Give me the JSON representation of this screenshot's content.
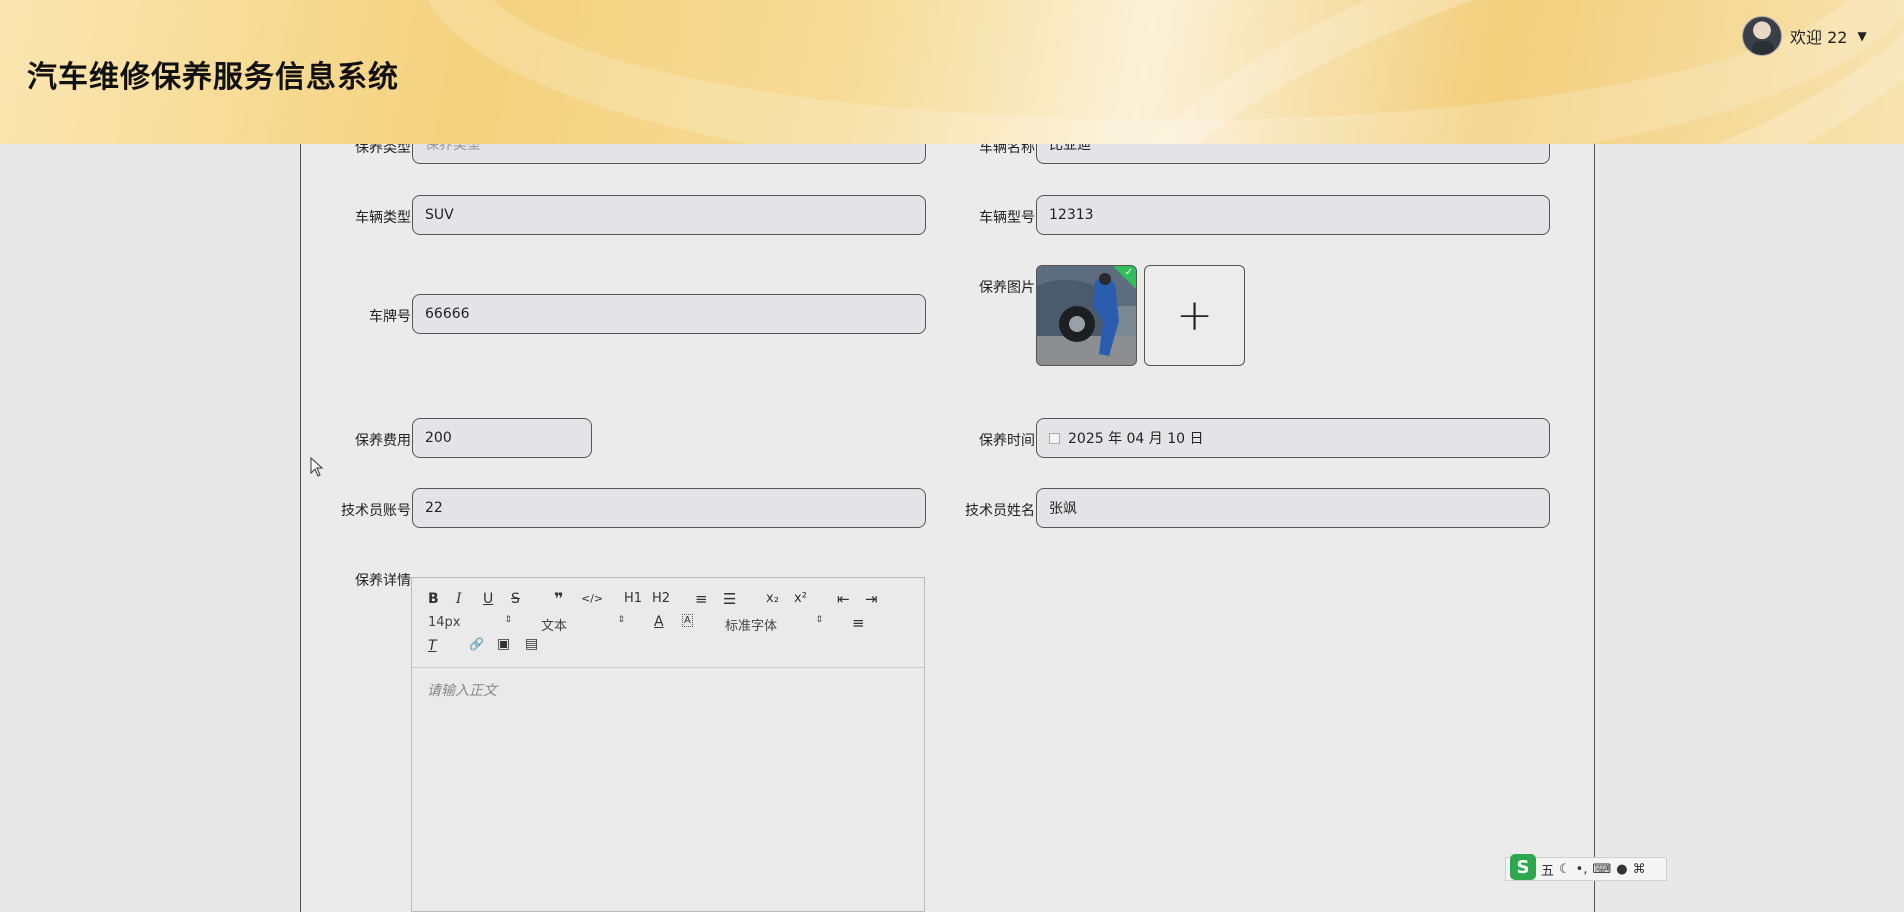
{
  "header": {
    "app_title": "汽车维修保养服务信息系统",
    "welcome": "欢迎 22",
    "caret": "▼"
  },
  "form": {
    "maintenance_type": {
      "label": "保养类型",
      "placeholder": "保养类型"
    },
    "vehicle_name": {
      "label": "车辆名称",
      "value": "比亚迪"
    },
    "vehicle_category": {
      "label": "车辆类型",
      "value": "SUV"
    },
    "vehicle_model": {
      "label": "车辆型号",
      "value": "12313"
    },
    "plate_number": {
      "label": "车牌号",
      "value": "66666"
    },
    "maintenance_image": {
      "label": "保养图片",
      "add_symbol": "+"
    },
    "maintenance_fee": {
      "label": "保养费用",
      "value": "200"
    },
    "maintenance_time": {
      "label": "保养时间",
      "value": "2025 年 04 月 10 日"
    },
    "technician_account": {
      "label": "技术员账号",
      "value": "22"
    },
    "technician_name": {
      "label": "技术员姓名",
      "value": "张飒"
    },
    "maintenance_details": {
      "label": "保养详情",
      "placeholder": "请输入正文",
      "toolbar": {
        "bold": "B",
        "italic": "I",
        "underline": "U",
        "strike": "S",
        "quote": "❞",
        "code": "</>",
        "h1": "H1",
        "h2": "H2",
        "ordered_list": "≡",
        "bullet_list": "☰",
        "subscript": "x₂",
        "superscript": "x²",
        "outdent": "⇤",
        "indent": "⇥",
        "font_size": "14px",
        "text_style": "文本",
        "font_color": "A",
        "bg_color": "A",
        "font_family": "标准字体",
        "align": "≡",
        "clear_format": "T",
        "link": "🔗",
        "image": "▣",
        "video": "▤",
        "select_arrow": "⇕"
      }
    }
  },
  "ime": {
    "label": "五",
    "icons": [
      "moon-icon",
      "punct-icon",
      "keyboard-icon",
      "user-icon",
      "grid-icon"
    ]
  }
}
